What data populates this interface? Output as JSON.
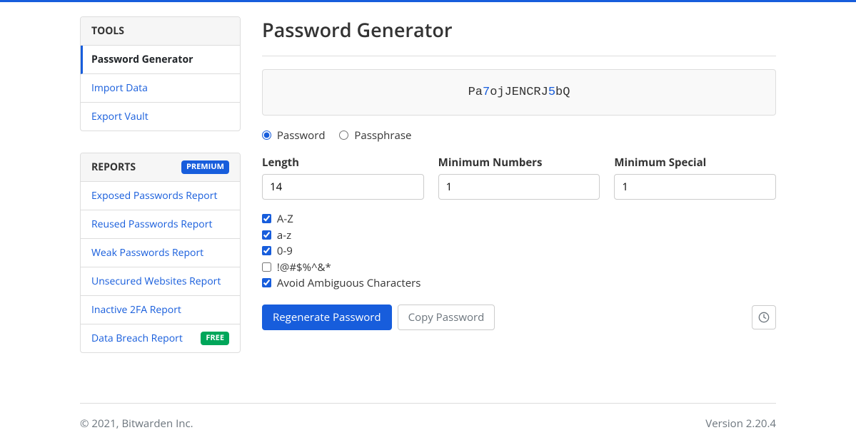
{
  "sidebar": {
    "tools": {
      "header": "Tools",
      "items": [
        {
          "label": "Password Generator",
          "active": true
        },
        {
          "label": "Import Data",
          "active": false
        },
        {
          "label": "Export Vault",
          "active": false
        }
      ]
    },
    "reports": {
      "header": "Reports",
      "badge": "Premium",
      "items": [
        {
          "label": "Exposed Passwords Report"
        },
        {
          "label": "Reused Passwords Report"
        },
        {
          "label": "Weak Passwords Report"
        },
        {
          "label": "Unsecured Websites Report"
        },
        {
          "label": "Inactive 2FA Report"
        },
        {
          "label": "Data Breach Report",
          "badge": "Free"
        }
      ]
    }
  },
  "main": {
    "title": "Password Generator",
    "password_chars": [
      {
        "c": "P",
        "t": "letter"
      },
      {
        "c": "a",
        "t": "letter"
      },
      {
        "c": "7",
        "t": "number"
      },
      {
        "c": "o",
        "t": "letter"
      },
      {
        "c": "j",
        "t": "letter"
      },
      {
        "c": "J",
        "t": "letter"
      },
      {
        "c": "E",
        "t": "letter"
      },
      {
        "c": "N",
        "t": "letter"
      },
      {
        "c": "C",
        "t": "letter"
      },
      {
        "c": "R",
        "t": "letter"
      },
      {
        "c": "J",
        "t": "letter"
      },
      {
        "c": "5",
        "t": "number"
      },
      {
        "c": "b",
        "t": "letter"
      },
      {
        "c": "Q",
        "t": "letter"
      }
    ],
    "type": {
      "password_label": "Password",
      "passphrase_label": "Passphrase",
      "selected": "password"
    },
    "fields": {
      "length": {
        "label": "Length",
        "value": "14"
      },
      "min_numbers": {
        "label": "Minimum Numbers",
        "value": "1"
      },
      "min_special": {
        "label": "Minimum Special",
        "value": "1"
      }
    },
    "options": {
      "uppercase": {
        "label": "A-Z",
        "checked": true
      },
      "lowercase": {
        "label": "a-z",
        "checked": true
      },
      "numbers": {
        "label": "0-9",
        "checked": true
      },
      "special": {
        "label": "!@#$%^&*",
        "checked": false
      },
      "ambiguous": {
        "label": "Avoid Ambiguous Characters",
        "checked": true
      }
    },
    "buttons": {
      "regenerate": "Regenerate Password",
      "copy": "Copy Password"
    }
  },
  "footer": {
    "copyright": "© 2021, Bitwarden Inc.",
    "version": "Version 2.20.4"
  }
}
